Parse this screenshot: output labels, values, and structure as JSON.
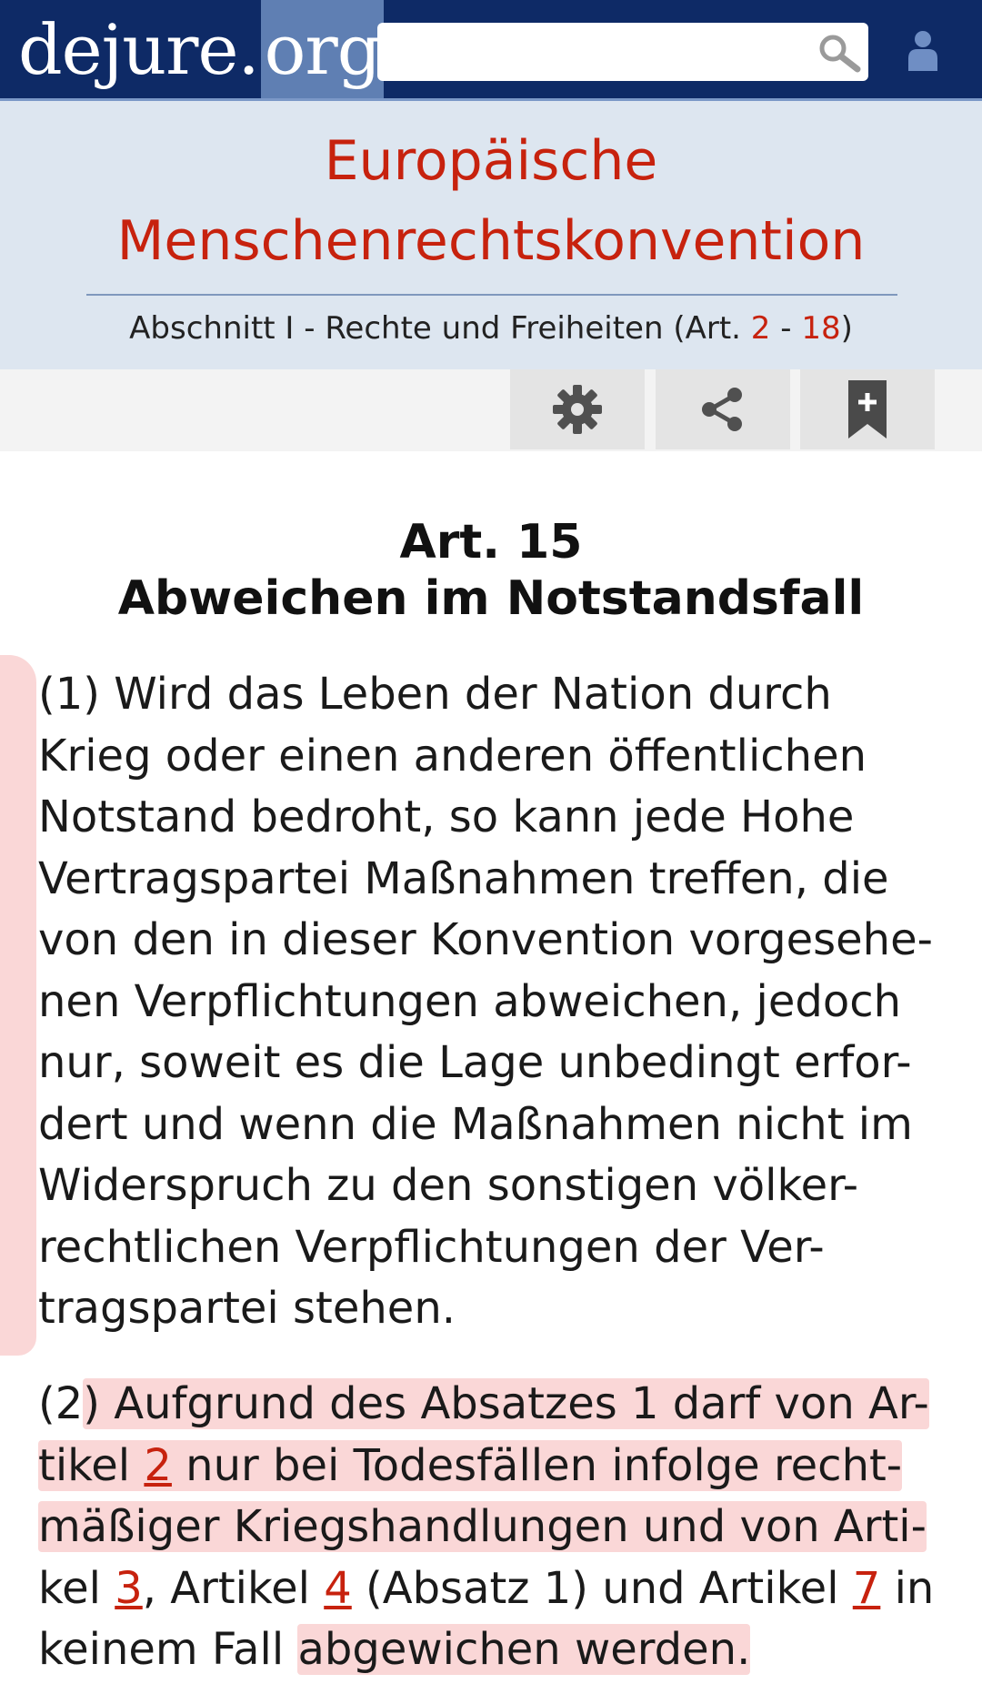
{
  "site": {
    "logo_main": "dejure.",
    "logo_tld": "org"
  },
  "search": {
    "value": ""
  },
  "header": {
    "title_line1": "Europäische",
    "title_line2": "Menschenrechtskonvention",
    "subtitle_prefix": "Abschnitt I - Rechte und Freiheiten (Art. ",
    "subtitle_ref1": "2",
    "subtitle_sep": " - ",
    "subtitle_ref2": "18",
    "subtitle_suffix": ")"
  },
  "toolbar": {
    "settings_icon": "gear-icon",
    "share_icon": "share-icon",
    "bookmark_icon": "bookmark-plus-icon"
  },
  "article": {
    "number": "Art. 15",
    "title": "Abweichen im Notstandsfall",
    "para1_lines": [
      "(1) Wird das Leben der Nation durch",
      "Krieg oder einen anderen öffentlichen",
      "Notstand bedroht, so kann jede Hohe",
      "Vertragspartei Maßnahmen treffen, die",
      "von den in dieser Konvention vorgesehe-",
      "nen Verpflichtungen abweichen, jedoch",
      "nur, soweit es die Lage unbedingt erfor-",
      "dert und wenn die Maßnahmen nicht im",
      "Widerspruch zu den sonstigen völker-",
      "rechtlichen Verpflichtungen der Ver-",
      "tragspartei stehen."
    ],
    "para2": {
      "l1a": "(2",
      "l1b": ") Aufgrund des Absatzes 1 darf von Ar-",
      "l2a": "tikel ",
      "l2ref": "2",
      "l2b": " nur bei Todesfällen infolge recht-",
      "l3": "mäßiger Kriegshandlungen und von Arti-",
      "l4a": "kel ",
      "l4ref1": "3",
      "l4b": ", Artikel ",
      "l4ref2": "4",
      "l4c": " (Absatz 1) und Artikel ",
      "l4ref3": "7",
      "l4d": " in",
      "l5a": "keinem Fall ",
      "l5b": "abgewichen werden."
    }
  },
  "colors": {
    "topbar": "#0e2a66",
    "header_bg": "#dde6f0",
    "title_red": "#c7220e",
    "highlight": "#f08c8c"
  }
}
